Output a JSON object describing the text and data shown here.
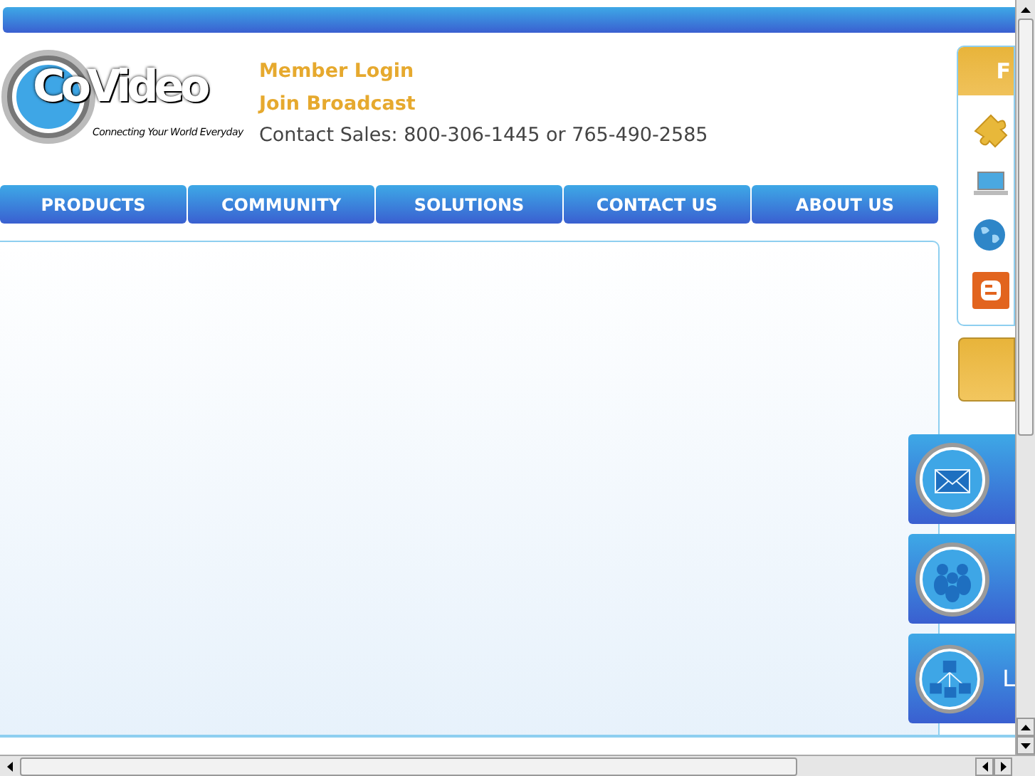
{
  "logo": {
    "name": "CoVideo",
    "tagline": "Connecting Your World Everyday"
  },
  "header_links": [
    "Member Login",
    "Join Broadcast"
  ],
  "contact": "Contact Sales: 800-306-1445 or 765-490-2585",
  "nav": [
    {
      "label": "PRODUCTS"
    },
    {
      "label": "COMMUNITY"
    },
    {
      "label": "SOLUTIONS"
    },
    {
      "label": "CONTACT US"
    },
    {
      "label": "ABOUT US"
    }
  ],
  "follow_panel": {
    "title": "F",
    "icons": [
      {
        "kind": "puzzle"
      },
      {
        "kind": "laptop"
      },
      {
        "kind": "globe"
      },
      {
        "kind": "blogger"
      }
    ]
  },
  "cards": [
    {
      "kind": "mail"
    },
    {
      "kind": "people"
    },
    {
      "kind": "network",
      "label": "L"
    }
  ]
}
